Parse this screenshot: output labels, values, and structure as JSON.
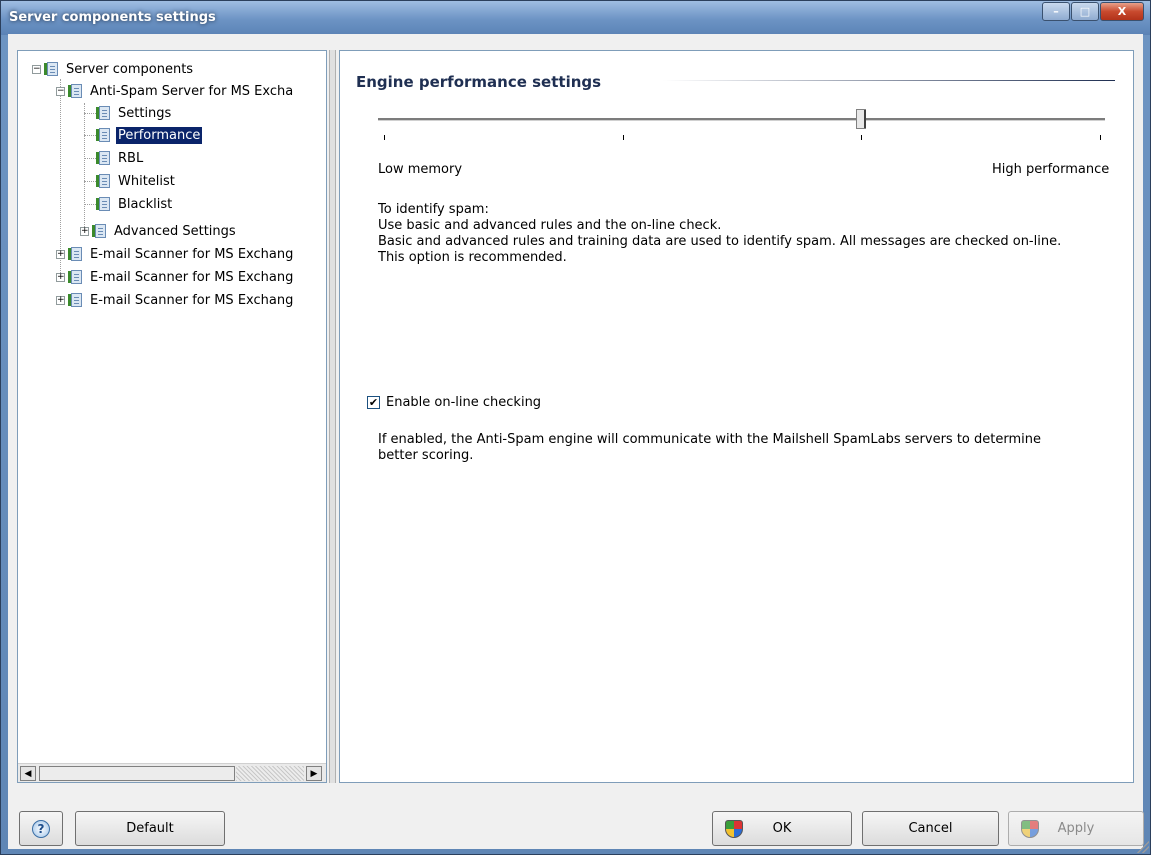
{
  "window": {
    "title": "Server components settings",
    "controls": {
      "minimize": "–",
      "maximize": "□",
      "close": "X"
    }
  },
  "tree": {
    "items": [
      {
        "label": "Server components",
        "expander": "−"
      },
      {
        "label": "Anti-Spam Server for MS Excha",
        "expander": "−"
      },
      {
        "label": "Settings"
      },
      {
        "label": "Performance",
        "selected": true
      },
      {
        "label": "RBL"
      },
      {
        "label": "Whitelist"
      },
      {
        "label": "Blacklist"
      },
      {
        "label": "Advanced Settings",
        "expander": "+"
      },
      {
        "label": "E-mail Scanner for MS Exchang",
        "expander": "+"
      },
      {
        "label": "E-mail Scanner for MS Exchang",
        "expander": "+"
      },
      {
        "label": "E-mail Scanner for MS Exchang",
        "expander": "+"
      }
    ],
    "scroll_left": "◀",
    "scroll_right": "▶"
  },
  "panel": {
    "heading": "Engine performance settings",
    "slider": {
      "min_label": "Low memory",
      "max_label": "High performance",
      "positions": 4,
      "selected_index": 2
    },
    "description": {
      "line1": "To identify spam:",
      "line2": "Use basic and advanced rules and the on-line check.",
      "line3": "Basic and advanced rules and training data are used to identify spam. All messages are checked on-line.",
      "line4": "This option is recommended."
    },
    "online_checkbox": {
      "label": "Enable on-line checking",
      "checked": true,
      "check_glyph": "✔"
    },
    "online_help": {
      "line1": "If enabled, the Anti-Spam engine will communicate with the Mailshell SpamLabs servers to determine",
      "line2": "better scoring."
    }
  },
  "buttons": {
    "help": "?",
    "default": "Default",
    "ok": "OK",
    "cancel": "Cancel",
    "apply": "Apply"
  },
  "colors": {
    "selection": "#0a246a",
    "heading": "#1f2f52",
    "title_bar": "#6c93c4"
  }
}
